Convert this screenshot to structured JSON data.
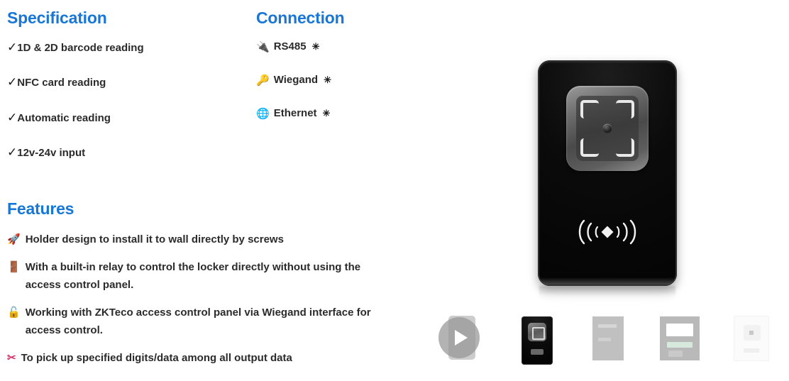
{
  "specification": {
    "heading": "Specification",
    "items": [
      {
        "check": "✓",
        "label": "1D & 2D barcode reading"
      },
      {
        "check": "✓",
        "label": "NFC card reading"
      },
      {
        "check": "✓",
        "label": "Automatic reading"
      },
      {
        "check": "✓",
        "label": "12v-24v input"
      }
    ]
  },
  "connection": {
    "heading": "Connection",
    "items": [
      {
        "icon": "plug-icon",
        "glyph": "🔌",
        "label": "RS485",
        "suffix_icon": "eight-pointed-star-icon",
        "suffix": "✳"
      },
      {
        "icon": "key-icon",
        "glyph": "🔑",
        "label": "Wiegand",
        "suffix_icon": "eight-pointed-star-icon",
        "suffix": "✳"
      },
      {
        "icon": "globe-icon",
        "glyph": "🌐",
        "label": "Ethernet",
        "suffix_icon": "eight-pointed-star-icon",
        "suffix": "✳"
      }
    ]
  },
  "features": {
    "heading": "Features",
    "items": [
      {
        "icon": "rocket-icon",
        "glyph": "🚀",
        "text": "Holder design to install it to wall directly by screws"
      },
      {
        "icon": "door-icon",
        "glyph": "🚪",
        "text": "With a built-in relay to control the locker directly without using the access control panel."
      },
      {
        "icon": "unlock-icon",
        "glyph": "🔓",
        "text": "Working with ZKTeco access control panel via Wiegand interface for access control."
      },
      {
        "icon": "scissors-icon",
        "glyph": "✂",
        "text": "To pick up specified digits/data among all output data"
      }
    ]
  },
  "product": {
    "hero_alt": "black qr code and nfc card reader",
    "scanner_window_label": "barcode scanner window",
    "nfc_symbol_label": "nfc contactless symbol"
  },
  "thumbnails": [
    {
      "name": "thumbnail-video",
      "label": "video",
      "selected": false
    },
    {
      "name": "thumbnail-1",
      "label": "product front black",
      "selected": true
    },
    {
      "name": "thumbnail-2",
      "label": "product gray",
      "selected": false
    },
    {
      "name": "thumbnail-3",
      "label": "product detail",
      "selected": false
    },
    {
      "name": "thumbnail-4",
      "label": "product white",
      "selected": false
    }
  ],
  "colors": {
    "heading_blue": "#1877d6",
    "body_text": "#2b2b2b",
    "device_black": "#0a0a0a",
    "page_background": "#ffffff"
  }
}
